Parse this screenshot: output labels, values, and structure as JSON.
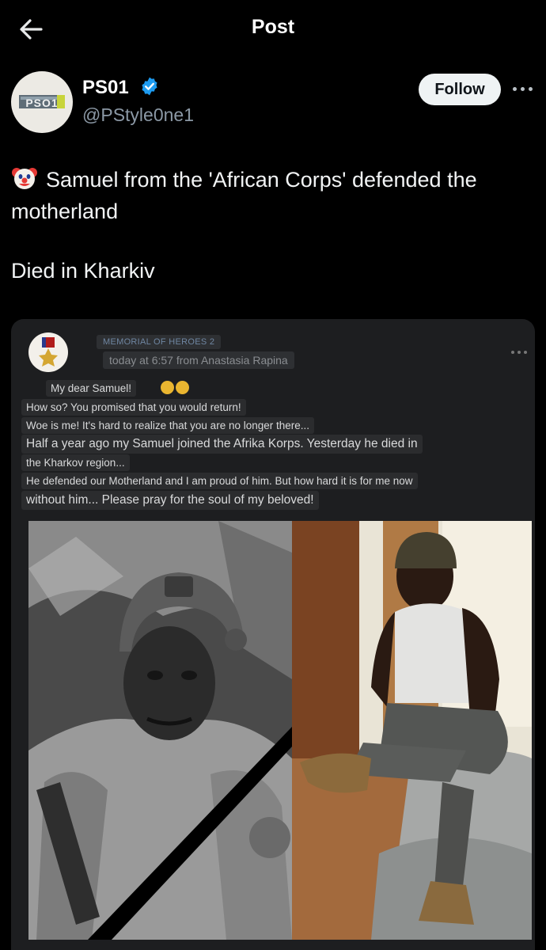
{
  "header": {
    "title": "Post",
    "back_icon": "back-arrow-icon"
  },
  "author": {
    "name": "PS01",
    "handle": "@PStyle0ne1",
    "avatar_text": "PSO1",
    "follow_label": "Follow",
    "verified_icon": "verified-badge-icon",
    "more_icon": "more-options-icon"
  },
  "tweet": {
    "emoji_icon": "clown-face-icon",
    "line1": "Samuel from the 'African Corps' defended the motherland",
    "line2": "Died in Kharkiv"
  },
  "embedded_post": {
    "group_name": "MEMORIAL OF HEROES 2",
    "meta": "today at 6:57 from Anastasia Rapina",
    "avatar_icon": "hero-medal-icon",
    "messages": [
      "My dear Samuel!",
      "How so? You promised that you would return!",
      "Woe is me! It's hard to realize that you are no longer there...",
      "Half a year ago my Samuel joined the Afrika Korps. Yesterday he died in",
      "the Kharkov region...",
      "He defended our Motherland and I am proud of him. But how hard it is for me now",
      "without him... Please pray for the soul of my beloved!"
    ],
    "photo_left_icon": "soldier-portrait-bw-photo",
    "photo_right_icon": "man-seated-photo"
  },
  "colors": {
    "background": "#000000",
    "card": "#1d1e20",
    "verified": "#1d9bf0",
    "handle": "#8b98a5"
  }
}
